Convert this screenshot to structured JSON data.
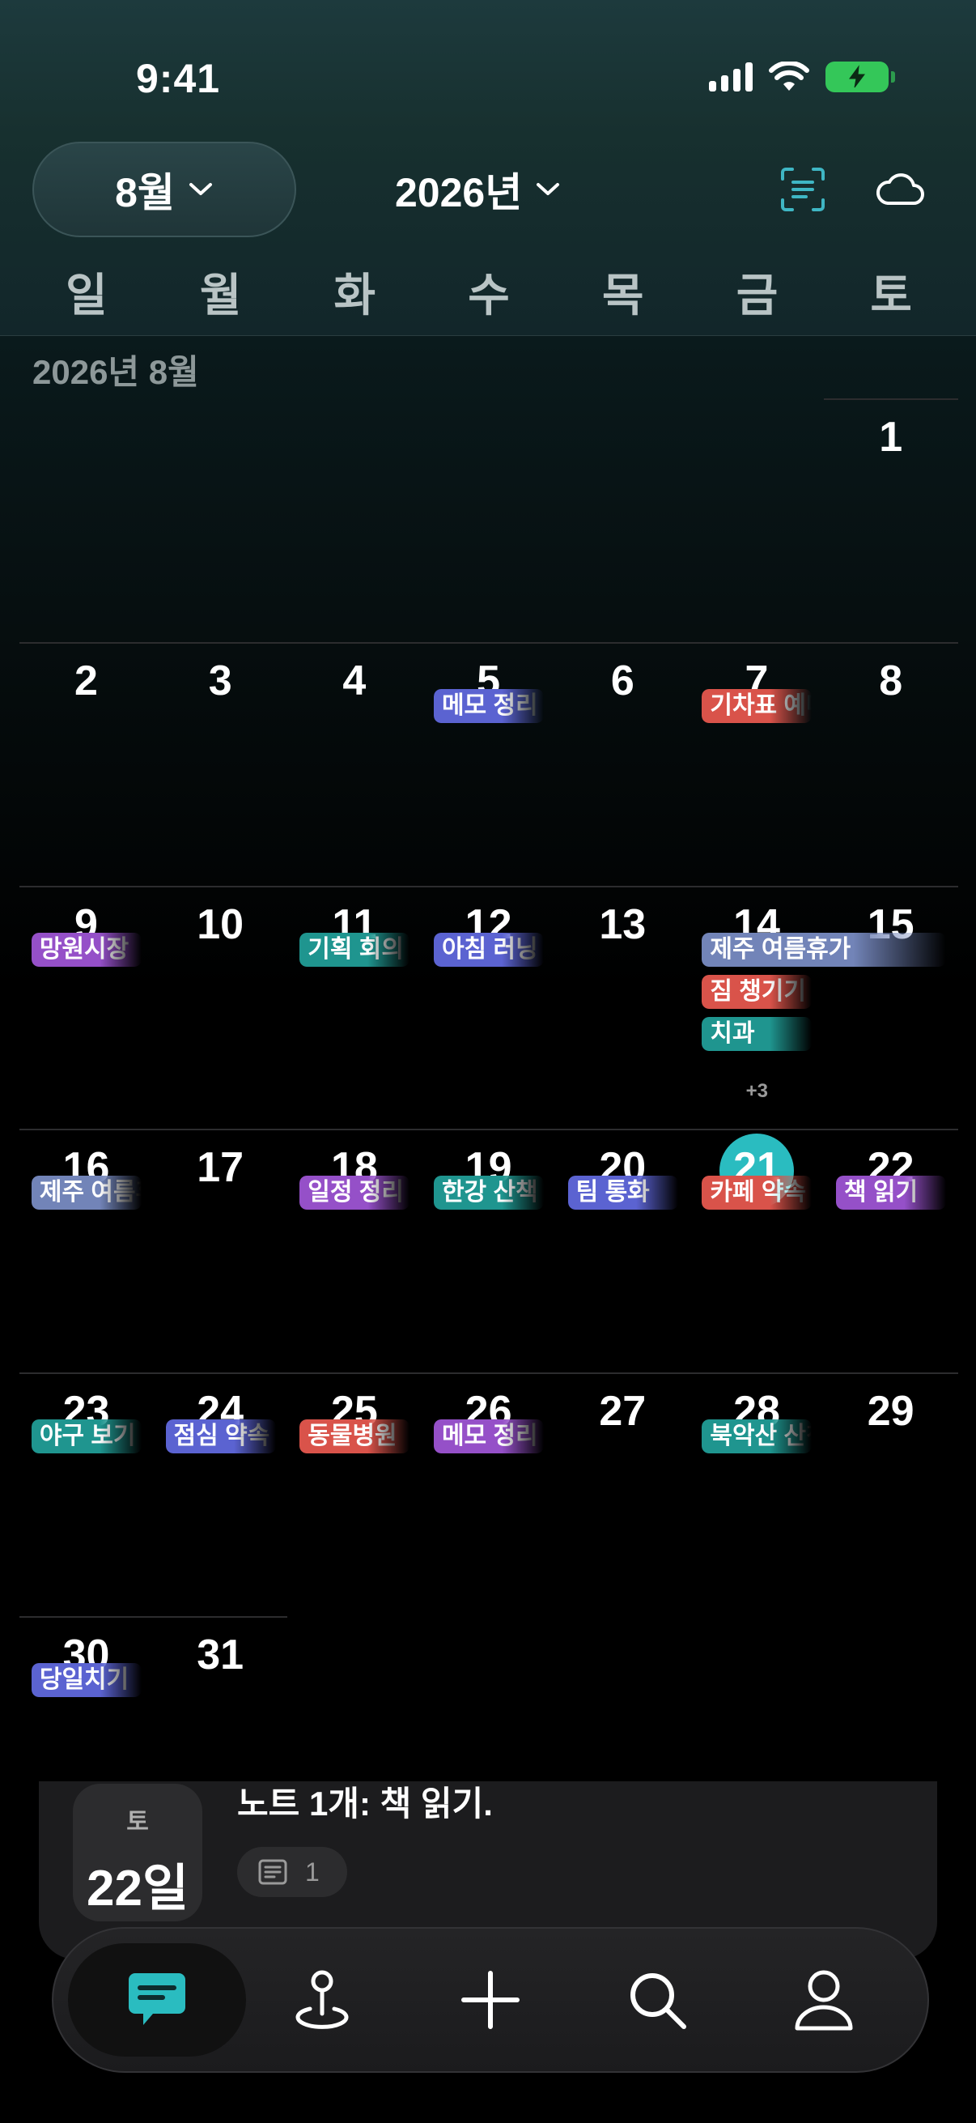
{
  "status_bar": {
    "time": "9:41"
  },
  "toolbar": {
    "month": "8월",
    "year": "2026년",
    "icons": [
      "document-scan-icon",
      "cloud-icon"
    ]
  },
  "weekdays": [
    "일",
    "월",
    "화",
    "수",
    "목",
    "금",
    "토"
  ],
  "month_label": "2026년 8월",
  "weeks": [
    {
      "days": [
        null,
        null,
        null,
        null,
        null,
        null,
        "1"
      ]
    },
    {
      "days": [
        "2",
        "3",
        "4",
        "5",
        "6",
        "7",
        "8"
      ]
    },
    {
      "days": [
        "9",
        "10",
        "11",
        "12",
        "13",
        "14",
        "15"
      ]
    },
    {
      "days": [
        "16",
        "17",
        "18",
        "19",
        "20",
        "21",
        "22"
      ]
    },
    {
      "days": [
        "23",
        "24",
        "25",
        "26",
        "27",
        "28",
        "29"
      ]
    },
    {
      "days": [
        "30",
        "31",
        null,
        null,
        null,
        null,
        null
      ]
    }
  ],
  "today": "21",
  "events": [
    {
      "week": 1,
      "col": 3,
      "slot": 0,
      "span": 1,
      "label": "메모 정리",
      "color": "#5b63d1"
    },
    {
      "week": 1,
      "col": 5,
      "slot": 0,
      "span": 1,
      "label": "기차표 예매",
      "color": "#d9534a"
    },
    {
      "week": 2,
      "col": 0,
      "slot": 0,
      "span": 1,
      "label": "망원시장",
      "color": "#9550c8"
    },
    {
      "week": 2,
      "col": 2,
      "slot": 0,
      "span": 1,
      "label": "기획 회의",
      "color": "#1f958f"
    },
    {
      "week": 2,
      "col": 3,
      "slot": 0,
      "span": 1,
      "label": "아침 러닝",
      "color": "#5b63d1"
    },
    {
      "week": 2,
      "col": 5,
      "slot": 0,
      "span": 2,
      "label": "제주 여름휴가",
      "color": "#7284b8"
    },
    {
      "week": 2,
      "col": 5,
      "slot": 1,
      "span": 1,
      "label": "짐 챙기기",
      "color": "#d9534a"
    },
    {
      "week": 2,
      "col": 5,
      "slot": 2,
      "span": 1,
      "label": "치과",
      "color": "#1f958f"
    },
    {
      "week": 3,
      "col": 0,
      "slot": 0,
      "span": 1,
      "label": "제주 여름휴가",
      "color": "#7284b8"
    },
    {
      "week": 3,
      "col": 2,
      "slot": 0,
      "span": 1,
      "label": "일정 정리",
      "color": "#9550c8"
    },
    {
      "week": 3,
      "col": 3,
      "slot": 0,
      "span": 1,
      "label": "한강 산책",
      "color": "#1f958f"
    },
    {
      "week": 3,
      "col": 4,
      "slot": 0,
      "span": 1,
      "label": "팀 통화",
      "color": "#5b63d1"
    },
    {
      "week": 3,
      "col": 5,
      "slot": 0,
      "span": 1,
      "label": "카페 약속",
      "color": "#d9534a"
    },
    {
      "week": 3,
      "col": 6,
      "slot": 0,
      "span": 1,
      "label": "책 읽기",
      "color": "#9550c8"
    },
    {
      "week": 4,
      "col": 0,
      "slot": 0,
      "span": 1,
      "label": "야구 보기",
      "color": "#1f958f"
    },
    {
      "week": 4,
      "col": 1,
      "slot": 0,
      "span": 1,
      "label": "점심 약속",
      "color": "#5b63d1"
    },
    {
      "week": 4,
      "col": 2,
      "slot": 0,
      "span": 1,
      "label": "동물병원",
      "color": "#d9534a"
    },
    {
      "week": 4,
      "col": 3,
      "slot": 0,
      "span": 1,
      "label": "메모 정리",
      "color": "#9550c8"
    },
    {
      "week": 4,
      "col": 5,
      "slot": 0,
      "span": 1,
      "label": "북악산 산책",
      "color": "#1f958f"
    },
    {
      "week": 5,
      "col": 0,
      "slot": 0,
      "span": 1,
      "label": "당일치기",
      "color": "#5b63d1"
    }
  ],
  "more_badges": [
    {
      "week": 2,
      "col": 5,
      "label": "+3"
    }
  ],
  "selected_day": {
    "weekday": "토",
    "day": "22일",
    "note_summary": "노트 1개: 책 읽기.",
    "note_count": "1"
  },
  "tabbar": {
    "tabs": [
      "chat-icon",
      "map-pin-icon",
      "plus-icon",
      "search-icon",
      "profile-icon"
    ],
    "active": 0
  },
  "colors": {
    "accent": "#2abcc0",
    "battery": "#34c759"
  }
}
